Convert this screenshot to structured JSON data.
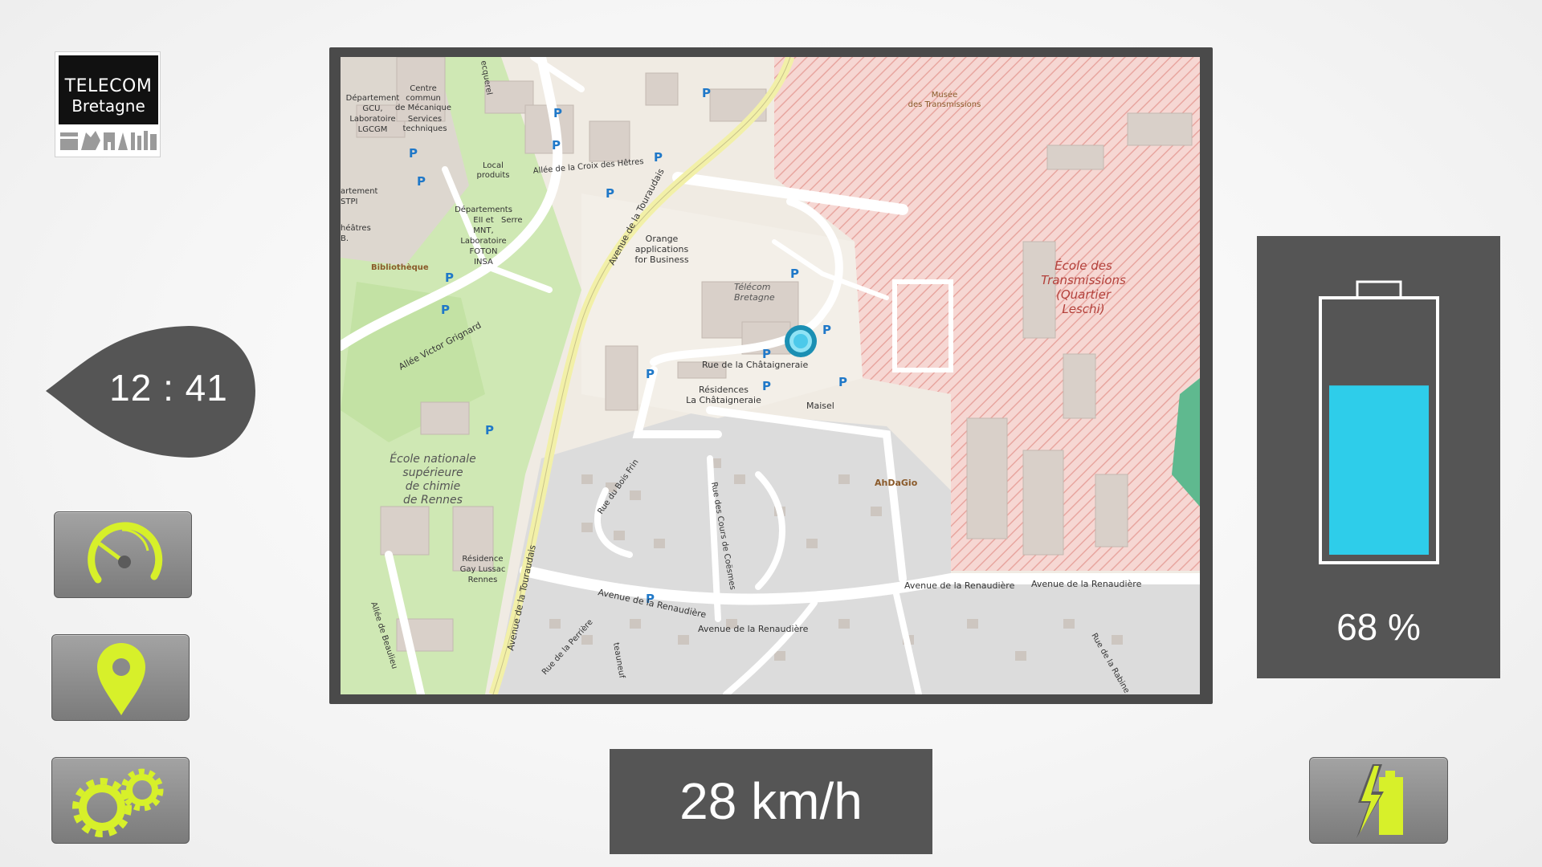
{
  "logo": {
    "line1": "TELECOM",
    "line2": "Bretagne"
  },
  "clock": {
    "time": "12 : 41"
  },
  "battery": {
    "percent_label": "68 %",
    "level": 0.68
  },
  "speed": {
    "label": "28 km/h"
  },
  "buttons": {
    "speedometer": {
      "icon": "speedometer-icon"
    },
    "map": {
      "icon": "location-pin-icon"
    },
    "settings": {
      "icon": "gears-icon"
    },
    "charge": {
      "icon": "battery-charge-icon"
    }
  },
  "colors": {
    "accent": "#d7f02a",
    "battery_fill": "#2ecdea",
    "panel": "#555555"
  },
  "map": {
    "labels": {
      "telecom": "Télécom",
      "bretagne": "Bretagne",
      "ecole_des": "École des",
      "transmissions": "Transmissions",
      "quartier": "(Quartier",
      "leschi": "Leschi)",
      "musee": "Musée",
      "des_transmissions": "des Transmissions",
      "orange1": "Orange",
      "orange2": "applications",
      "orange3": "for Business",
      "rue_chataigneraie": "Rue de la Châtaigneraie",
      "residences": "Résidences",
      "la_chataigneraie": "La Châtaigneraie",
      "maisel": "Maisel",
      "ahdagio": "AhDaGio",
      "avenue_touraudais": "Avenue de la Touraudais",
      "avenue_renaudiere": "Avenue de la Renaudière",
      "rue_bois_frin": "Rue du Bois Frin",
      "rue_cours_coesmes": "Rue des Cours de Coësmes",
      "allee_victor_grignard": "Allée Victor Grignard",
      "allee_croix_hetres": "Allée de la Croix des Hêtres",
      "allee_beaulieu": "Allée de Beaulieu",
      "rue_perriere": "Rue de la Perrière",
      "rue_rabine": "Rue de la Rabine",
      "bibliotheque": "Bibliothèque",
      "ecole_nat1": "École nationale",
      "ecole_nat2": "supérieure",
      "ecole_nat3": "de chimie",
      "ecole_nat4": "de Rennes",
      "residence_gl1": "Résidence",
      "residence_gl2": "Gay Lussac",
      "residence_gl3": "Rennes",
      "centre1": "Centre",
      "centre2": "commun",
      "centre3": "de Mécanique",
      "dept_gcu1": "Département",
      "dept_gcu2": "GCU,",
      "dept_gcu3": "Laboratoire",
      "dept_gcu4": "LGCGM",
      "services1": "Services",
      "services2": "techniques",
      "local1": "Local",
      "local2": "produits",
      "dept_em1": "Départements",
      "dept_em2": "EII et",
      "dept_em3": "MNT,",
      "dept_em4": "Laboratoire",
      "dept_em5": "FOTON",
      "dept_em6": "INSA",
      "serre": "Serre",
      "artement": "artement",
      "stpi": "STPI",
      "theatres": "héâtres",
      "b": "B.",
      "ecquerel": "ecquerel",
      "auneuf": "teauneuf"
    }
  }
}
